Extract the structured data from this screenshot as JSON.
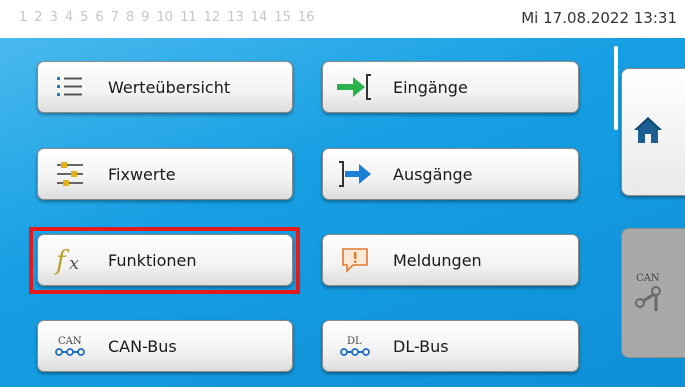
{
  "status_bar": {
    "pages": [
      "1",
      "2",
      "3",
      "4",
      "5",
      "6",
      "7",
      "8",
      "9",
      "10",
      "11",
      "12",
      "13",
      "14",
      "15",
      "16"
    ],
    "datetime": "Mi 17.08.2022 13:31"
  },
  "menu": {
    "werteuebersicht": {
      "label": "Werteübersicht",
      "icon": "list-icon"
    },
    "eingaenge": {
      "label": "Eingänge",
      "icon": "input-arrow-icon"
    },
    "fixwerte": {
      "label": "Fixwerte",
      "icon": "fixed-values-icon"
    },
    "ausgaenge": {
      "label": "Ausgänge",
      "icon": "output-arrow-icon"
    },
    "funktionen": {
      "label": "Funktionen",
      "icon": "function-fx-icon"
    },
    "meldungen": {
      "label": "Meldungen",
      "icon": "message-warning-icon"
    },
    "can_bus": {
      "label": "CAN-Bus",
      "icon": "can-bus-icon",
      "icon_text": "CAN"
    },
    "dl_bus": {
      "label": "DL-Bus",
      "icon": "dl-bus-icon",
      "icon_text": "DL"
    }
  },
  "side": {
    "home": {
      "icon": "home-icon"
    },
    "can": {
      "icon": "can-network-icon",
      "icon_text": "CAN"
    }
  },
  "colors": {
    "accent": "#169fe3",
    "highlight": "#e41a1c",
    "arrow_green": "#2db14a",
    "arrow_blue": "#1c7fd6"
  }
}
